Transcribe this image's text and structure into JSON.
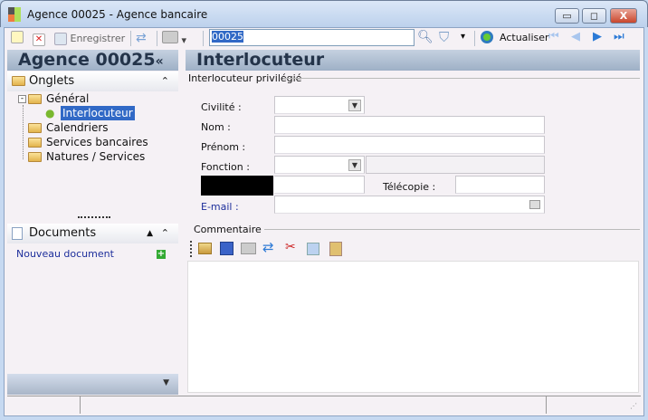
{
  "window": {
    "title": "Agence 00025 -  Agence bancaire",
    "min": "▭",
    "max": "◻",
    "close": "X"
  },
  "toolbar": {
    "save_label": "Enregistrer",
    "search_value": "00025",
    "refresh_label": "Actualiser"
  },
  "left": {
    "title": "Agence 00025",
    "collapse": "«",
    "tabs_header": "Onglets",
    "tree": [
      {
        "label": "Général"
      },
      {
        "label": "Interlocuteur"
      },
      {
        "label": "Calendriers"
      },
      {
        "label": "Services bancaires"
      },
      {
        "label": "Natures / Services"
      }
    ],
    "documents_header": "Documents",
    "new_document": "Nouveau document"
  },
  "main": {
    "title": "Interlocuteur",
    "group": "Interlocuteur privilégié",
    "fields": {
      "civilite": "Civilité :",
      "nom": "Nom :",
      "prenom": "Prénom :",
      "fonction": "Fonction :",
      "telecopie": "Télécopie :",
      "email": "E-mail :"
    },
    "comment_label": "Commentaire"
  },
  "colors": {
    "selection": "#3169c6",
    "email_label": "#1d2e9b",
    "header": "#24344a"
  }
}
